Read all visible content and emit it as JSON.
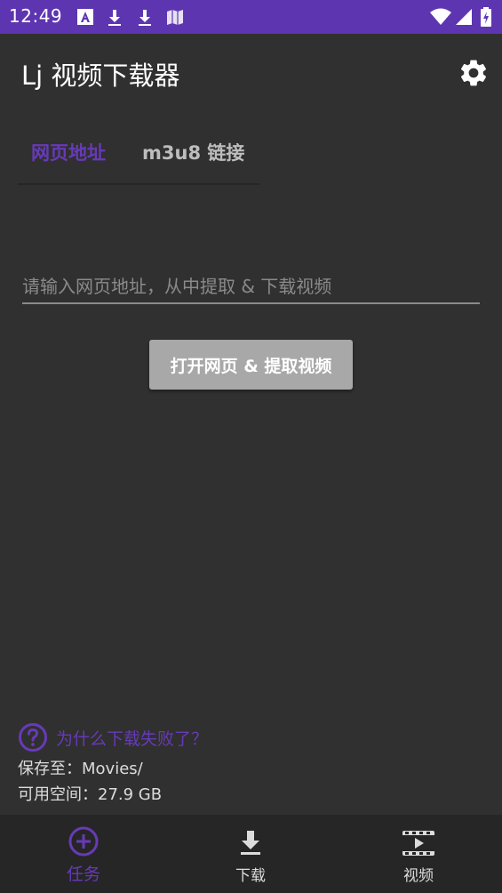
{
  "colors": {
    "status_bar": "#5e35b1",
    "background": "#303030",
    "accent": "#673ab7",
    "bottom_nav": "#262626",
    "button_disabled": "#a8a8a8"
  },
  "status_bar": {
    "time": "12:49",
    "icons": [
      "text-a-icon",
      "download-icon",
      "download-icon",
      "map-icon",
      "wifi-icon",
      "signal-icon",
      "battery-charging-icon"
    ]
  },
  "app_bar": {
    "title": "Lj 视频下载器",
    "settings_icon": "gear-icon"
  },
  "tabs": [
    {
      "label": "网页地址",
      "active": true
    },
    {
      "label": "m3u8 链接",
      "active": false
    }
  ],
  "url_input": {
    "placeholder": "请输入网页地址，从中提取 & 下载视频",
    "value": ""
  },
  "open_button": {
    "label": "打开网页 & 提取视频"
  },
  "help": {
    "icon": "help-circle-icon",
    "link": "为什么下载失败了？"
  },
  "storage": {
    "save_to": "保存至：Movies/",
    "free_space": "可用空间：27.9 GB"
  },
  "bottom_nav": [
    {
      "label": "任务",
      "icon": "add-circle-icon",
      "active": true
    },
    {
      "label": "下载",
      "icon": "download-icon",
      "active": false
    },
    {
      "label": "视频",
      "icon": "movie-icon",
      "active": false
    }
  ]
}
